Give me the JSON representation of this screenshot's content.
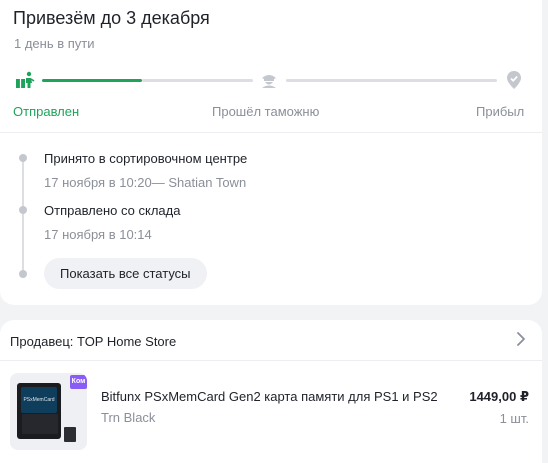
{
  "delivery": {
    "title": "Привезём до 3 декабря",
    "subtitle": "1 день в пути",
    "stages": [
      {
        "label": "Отправлен",
        "icon": "shipped-box-icon",
        "state": "done"
      },
      {
        "label": "Прошёл таможню",
        "icon": "customs-officer-icon",
        "state": "pending"
      },
      {
        "label": "Прибыл",
        "icon": "location-check-icon",
        "state": "pending"
      }
    ],
    "first_segment_progress": 0.5,
    "events": [
      {
        "text": "Принято в сортировочном центре",
        "meta": "17 ноября в 10:20— Shatian Town"
      },
      {
        "text": "Отправлено со склада",
        "meta": "17 ноября в 10:14"
      }
    ],
    "show_all_label": "Показать все статусы",
    "accent_color": "#1fa35a"
  },
  "order": {
    "seller_label": "Продавец: TOP Home Store",
    "product": {
      "name": "Bitfunx PSxMemCard Gen2 карта памяти для PS1 и PS2",
      "variant": "Trn Black",
      "price": "1449,00 ₽",
      "quantity": "1 шт.",
      "badge": "Ком",
      "image_label": "PSxMemCard"
    }
  }
}
